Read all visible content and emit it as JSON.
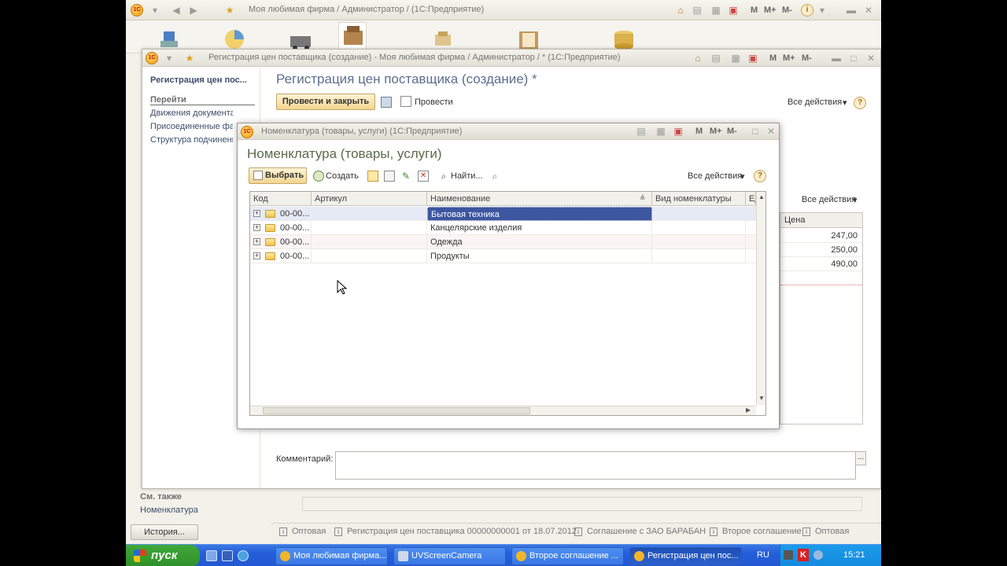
{
  "main_window": {
    "title": "Моя любимая фирма / Администратор / (1С:Предприятие)",
    "m_buttons": [
      "M",
      "M+",
      "M-"
    ]
  },
  "doc_window": {
    "title": "Регистрация цен поставщика (создание) - Моя любимая фирма / Администратор / * (1С:Предприятие)",
    "m_buttons": [
      "M",
      "M+",
      "M-"
    ],
    "heading": "Регистрация цен поставщика (создание) *",
    "post_and_close": "Провести и закрыть",
    "post": "Провести",
    "all_actions": "Все действия",
    "help": "?",
    "table_all_actions": "Все действия",
    "price_header": "Цена",
    "prices": [
      "247,00",
      "250,00",
      "490,00"
    ],
    "comment_label": "Комментарий:",
    "ellipsis": "...",
    "nav": {
      "title": "Регистрация цен пос...",
      "goto_header": "Перейти",
      "links": [
        "Движения документа",
        "Присоединенные фай...",
        "Структура подчиненн..."
      ]
    }
  },
  "see_also": {
    "header": "См. также",
    "link": "Номенклатура"
  },
  "history_button": "История...",
  "status_bar": [
    "Оптовая",
    "Регистрация цен поставщика 00000000001 от 18.07.2012",
    "Соглашение с ЗАО БАРАБАН",
    "Второе соглашение",
    "Оптовая"
  ],
  "dialog": {
    "title": "Номенклатура (товары, услуги)  (1С:Предприятие)",
    "m_buttons": [
      "M",
      "M+",
      "M-"
    ],
    "heading": "Номенклатура (товары, услуги)",
    "toolbar": {
      "select": "Выбрать",
      "create": "Создать",
      "find": "Найти...",
      "all_actions": "Все действия",
      "help": "?"
    },
    "columns": [
      "Код",
      "Артикул",
      "Наименование",
      "Вид номенклатуры",
      "Ед"
    ],
    "rows": [
      {
        "code": "00-00...",
        "article": "",
        "name": "Бытовая техника",
        "kind": ""
      },
      {
        "code": "00-00...",
        "article": "",
        "name": "Канцелярские изделия",
        "kind": ""
      },
      {
        "code": "00-00...",
        "article": "",
        "name": "Одежда",
        "kind": ""
      },
      {
        "code": "00-00...",
        "article": "",
        "name": "Продукты",
        "kind": ""
      }
    ]
  },
  "taskbar": {
    "start": "пуск",
    "tasks": [
      "Моя любимая фирма...",
      "UVScreenCamera",
      "Второе соглашение ...",
      "Регистрация цен пос..."
    ],
    "language": "RU",
    "clock": "15:21"
  }
}
